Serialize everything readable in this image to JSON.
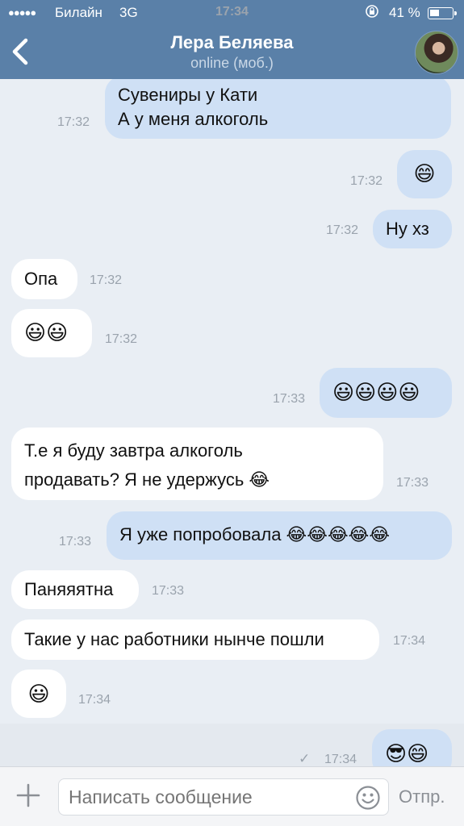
{
  "status_bar": {
    "signal": "●●●●●",
    "carrier": "Билайн",
    "network": "3G",
    "time": "17:34",
    "battery": "41 %"
  },
  "header": {
    "title": "Лера Беляева",
    "subtitle": "online (моб.)"
  },
  "messages": [
    {
      "dir": "out",
      "lines": [
        "Сувениры у Кати",
        "А у меня алкоголь"
      ],
      "time": "17:32"
    },
    {
      "dir": "out",
      "text": "😄",
      "time": "17:32"
    },
    {
      "dir": "out",
      "text": "Ну хз",
      "time": "17:32"
    },
    {
      "dir": "in",
      "text": "Опа",
      "time": "17:32"
    },
    {
      "dir": "in",
      "text": "😃😃",
      "time": "17:32"
    },
    {
      "dir": "out",
      "text": "😃😃😃😃",
      "time": "17:33"
    },
    {
      "dir": "in",
      "lines": [
        "Т.е я буду завтра алкоголь",
        "продавать? Я не удержусь 😂"
      ],
      "time": "17:33"
    },
    {
      "dir": "out",
      "text": "Я уже попробовала 😂😂😂😂😂",
      "time": "17:33"
    },
    {
      "dir": "in",
      "text": "Паняяятна",
      "time": "17:33"
    },
    {
      "dir": "in",
      "text": "Такие у нас работники нынче пошли",
      "time": "17:34"
    },
    {
      "dir": "in",
      "text": "😃",
      "time": "17:34"
    },
    {
      "dir": "out",
      "text": "😎😄",
      "time": "17:34",
      "read_check": "✓"
    }
  ],
  "composer": {
    "placeholder": "Написать сообщение",
    "send_label": "Отпр."
  },
  "colors": {
    "header_bg": "#5a80a8",
    "outgoing_bubble": "#cfe0f5",
    "incoming_bubble": "#ffffff",
    "chat_bg": "#e9eef4"
  },
  "icons": [
    "back-chevron-icon",
    "plus-icon",
    "smiley-icon",
    "lock-rotation-icon",
    "battery-icon"
  ]
}
